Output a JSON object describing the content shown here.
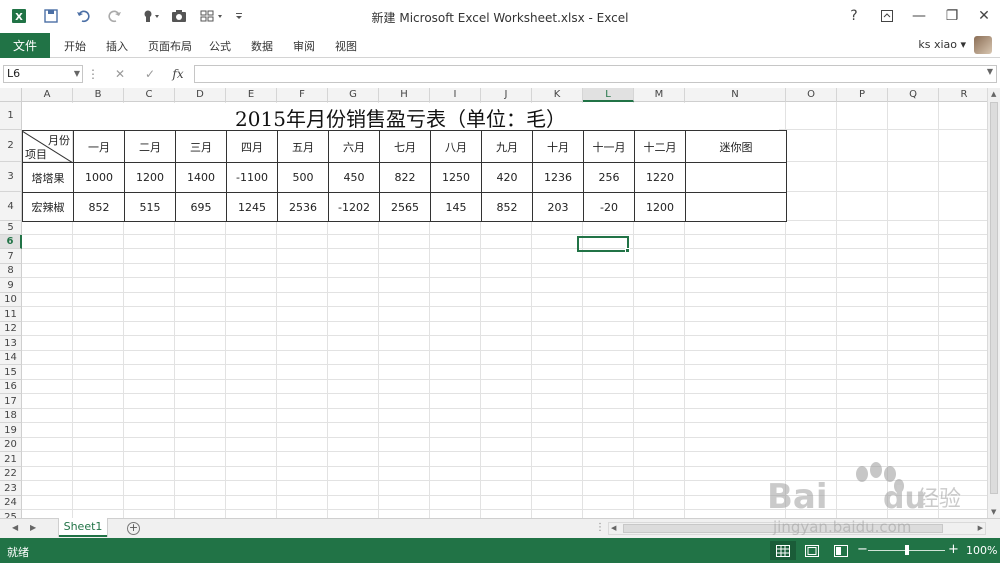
{
  "window": {
    "title": "新建 Microsoft Excel Worksheet.xlsx - Excel",
    "help": "?",
    "minimize": "—",
    "restore": "❐",
    "close": "✕",
    "app_icon": "excel-logo"
  },
  "ribbon": {
    "file_tab": "文件",
    "tabs": [
      "开始",
      "插入",
      "页面布局",
      "公式",
      "数据",
      "审阅",
      "视图"
    ],
    "user": "ks xiao ▾"
  },
  "formula_bar": {
    "name_box": "L6",
    "fx": "fx",
    "value": ""
  },
  "grid": {
    "columns": [
      "A",
      "B",
      "C",
      "D",
      "E",
      "F",
      "G",
      "H",
      "I",
      "J",
      "K",
      "L",
      "M",
      "N",
      "O",
      "P",
      "Q",
      "R"
    ],
    "rows": [
      "1",
      "2",
      "3",
      "4",
      "5",
      "6",
      "7",
      "8",
      "9",
      "10",
      "11",
      "12",
      "13",
      "14",
      "15",
      "16",
      "17",
      "18",
      "19",
      "20",
      "21",
      "22",
      "23",
      "24",
      "25"
    ],
    "selected_column": "L",
    "selected_row": "6"
  },
  "table": {
    "title": "2015年月份销售盈亏表（单位：毛）",
    "header_top": "月份",
    "header_bottom": "项目",
    "months": [
      "一月",
      "二月",
      "三月",
      "四月",
      "五月",
      "六月",
      "七月",
      "八月",
      "九月",
      "十月",
      "十一月",
      "十二月"
    ],
    "sparkline_header": "迷你图",
    "rows": [
      {
        "name": "塔塔果",
        "values": [
          "1000",
          "1200",
          "1400",
          "-1100",
          "500",
          "450",
          "822",
          "1250",
          "420",
          "1236",
          "256",
          "1220"
        ]
      },
      {
        "name": "宏辣椒",
        "values": [
          "852",
          "515",
          "695",
          "1245",
          "2536",
          "-1202",
          "2565",
          "145",
          "852",
          "203",
          "-20",
          "1200"
        ]
      }
    ]
  },
  "sheets": {
    "active": "Sheet1"
  },
  "status": {
    "ready": "就绪",
    "zoom_minus": "−",
    "zoom_plus": "+",
    "zoom": "100%",
    "zoom_level_pct": 50
  },
  "watermark": {
    "brand": "Bai",
    "brand2": "du",
    "cn": "经验",
    "url": "jingyan.baidu.com"
  },
  "colors": {
    "accent": "#217346",
    "status_bar": "#217346"
  }
}
